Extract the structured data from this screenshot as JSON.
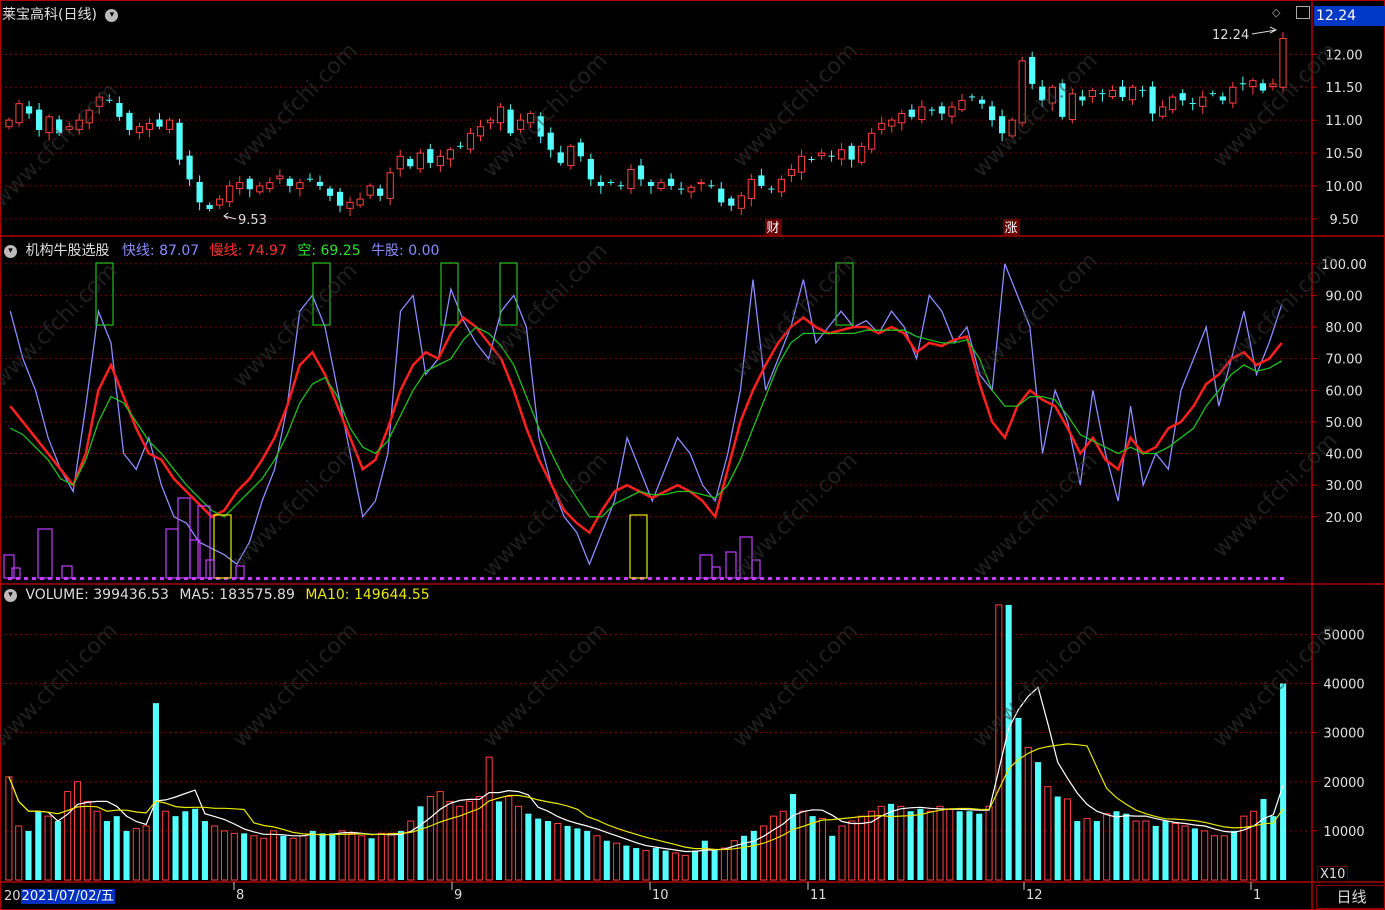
{
  "stock_title": "莱宝高科(日线)",
  "price_badge": "12.24",
  "period_tab": "日线",
  "x10_label": "X10",
  "ind_header": {
    "name": "机构牛股选股",
    "fast_label": "快线:",
    "fast": "87.07",
    "slow_label": "慢线:",
    "slow": "74.97",
    "empty_label": "空:",
    "empty": "69.25",
    "bull_label": "牛股:",
    "bull": "0.00"
  },
  "vol_header": {
    "name": "VOLUME:",
    "vol": "399436.53",
    "ma5_label": "MA5:",
    "ma5": "183575.89",
    "ma10_label": "MA10:",
    "ma10": "149644.55"
  },
  "bottom": {
    "year_prefix": "20",
    "date": "2021/07/02/五",
    "months": [
      {
        "label": "8",
        "x": 234
      },
      {
        "label": "9",
        "x": 452
      },
      {
        "label": "10",
        "x": 650
      },
      {
        "label": "11",
        "x": 808
      },
      {
        "label": "12",
        "x": 1024
      },
      {
        "label": "1",
        "x": 1251
      }
    ]
  },
  "markers": [
    {
      "text": "财",
      "x": 773
    },
    {
      "text": "涨",
      "x": 1011
    }
  ],
  "annotations": {
    "high": "12.24",
    "low": "9.53"
  },
  "watermark": "www.cfchi.com",
  "colors": {
    "up": "#ff4040",
    "down": "#54ffff",
    "slow": "#ff2020",
    "fast": "#8c8cff",
    "green": "#20c020",
    "purple": "#c040ff",
    "yellow": "#e8e800",
    "grid": "#800000",
    "frame": "#b00000"
  },
  "chart_data": [
    {
      "type": "candlestick",
      "title": "莱宝高科(日线)",
      "yticks": [
        9.5,
        10.0,
        10.5,
        11.0,
        11.5,
        12.0
      ],
      "ylim": [
        9.3,
        12.4
      ],
      "close": [
        11.0,
        11.25,
        11.1,
        10.85,
        11.05,
        10.8,
        10.9,
        11.0,
        11.15,
        11.35,
        11.3,
        11.05,
        10.85,
        10.9,
        10.95,
        10.9,
        11.0,
        10.4,
        10.1,
        9.75,
        9.65,
        9.8,
        10.0,
        10.05,
        9.95,
        10.0,
        10.05,
        10.15,
        10.0,
        10.05,
        10.1,
        10.0,
        9.85,
        9.7,
        9.75,
        9.8,
        10.0,
        9.85,
        10.2,
        10.45,
        10.3,
        10.5,
        10.35,
        10.45,
        10.55,
        10.6,
        10.8,
        10.9,
        11.0,
        11.2,
        10.8,
        11.0,
        11.1,
        10.75,
        10.55,
        10.35,
        10.6,
        10.45,
        10.1,
        10.0,
        10.05,
        10.0,
        10.25,
        10.1,
        10.0,
        10.05,
        10.0,
        9.95,
        9.98,
        10.05,
        10.0,
        9.75,
        9.7,
        9.85,
        10.1,
        10.0,
        9.95,
        10.1,
        10.25,
        10.45,
        10.4,
        10.5,
        10.45,
        10.55,
        10.4,
        10.6,
        10.8,
        10.95,
        11.0,
        11.1,
        11.05,
        11.2,
        11.15,
        11.1,
        11.2,
        11.3,
        11.35,
        11.25,
        11.0,
        10.8,
        11.0,
        11.9,
        11.55,
        11.3,
        11.5,
        11.05,
        11.4,
        11.3,
        11.45,
        11.4,
        11.45,
        11.35,
        11.5,
        11.45,
        11.1,
        11.2,
        11.35,
        11.3,
        11.25,
        11.35,
        11.4,
        11.3,
        11.5,
        11.55,
        11.6,
        11.45,
        11.55,
        12.24
      ],
      "high": 12.24,
      "low": 9.53
    },
    {
      "type": "line",
      "title": "机构牛股选股",
      "yticks": [
        20,
        30,
        40,
        50,
        60,
        70,
        80,
        90,
        100
      ],
      "ylim": [
        0,
        105
      ],
      "series": [
        {
          "name": "快线",
          "values": [
            85,
            70,
            60,
            45,
            35,
            28,
            55,
            85,
            75,
            40,
            35,
            45,
            30,
            20,
            18,
            12,
            10,
            8,
            5,
            12,
            25,
            35,
            55,
            85,
            90,
            80,
            60,
            40,
            20,
            25,
            40,
            85,
            90,
            65,
            70,
            92,
            82,
            75,
            70,
            85,
            90,
            80,
            45,
            30,
            20,
            15,
            5,
            15,
            25,
            45,
            35,
            25,
            35,
            45,
            40,
            30,
            25,
            40,
            60,
            95,
            60,
            70,
            80,
            95,
            75,
            80,
            85,
            80,
            82,
            78,
            85,
            80,
            70,
            90,
            85,
            75,
            80,
            65,
            60,
            100,
            90,
            80,
            40,
            60,
            50,
            30,
            60,
            40,
            25,
            55,
            30,
            40,
            35,
            60,
            70,
            80,
            55,
            70,
            85,
            65,
            75,
            87.07
          ]
        },
        {
          "name": "慢线",
          "values": [
            55,
            50,
            45,
            40,
            35,
            30,
            40,
            60,
            68,
            58,
            48,
            40,
            38,
            32,
            28,
            24,
            20,
            22,
            28,
            32,
            38,
            45,
            55,
            68,
            72,
            65,
            55,
            45,
            35,
            38,
            48,
            60,
            68,
            72,
            70,
            78,
            83,
            80,
            75,
            70,
            60,
            48,
            38,
            30,
            22,
            18,
            15,
            22,
            28,
            30,
            28,
            26,
            28,
            30,
            28,
            25,
            20,
            35,
            50,
            60,
            68,
            75,
            80,
            83,
            80,
            78,
            79,
            80,
            80,
            78,
            80,
            78,
            72,
            75,
            74,
            76,
            77,
            62,
            50,
            45,
            55,
            60,
            57,
            55,
            48,
            40,
            45,
            38,
            35,
            45,
            40,
            42,
            48,
            50,
            55,
            62,
            65,
            70,
            72,
            68,
            70,
            74.97
          ]
        },
        {
          "name": "空",
          "values": [
            48,
            46,
            42,
            38,
            32,
            30,
            38,
            50,
            58,
            56,
            50,
            44,
            40,
            35,
            30,
            26,
            22,
            20,
            24,
            28,
            32,
            38,
            46,
            56,
            62,
            64,
            58,
            48,
            42,
            40,
            44,
            52,
            60,
            66,
            68,
            70,
            76,
            80,
            78,
            74,
            68,
            58,
            48,
            40,
            32,
            26,
            20,
            20,
            24,
            26,
            28,
            27,
            27,
            28,
            28,
            27,
            26,
            30,
            38,
            48,
            58,
            68,
            75,
            78,
            78,
            78,
            78,
            78,
            79,
            79,
            79,
            79,
            77,
            76,
            75,
            75,
            76,
            70,
            60,
            55,
            55,
            58,
            58,
            57,
            52,
            46,
            44,
            42,
            40,
            42,
            40,
            40,
            42,
            45,
            48,
            55,
            60,
            65,
            68,
            66,
            67,
            69.25
          ]
        },
        {
          "name": "牛股",
          "values": [
            0
          ]
        }
      ]
    },
    {
      "type": "bar",
      "title": "VOLUME",
      "yticks": [
        10000,
        20000,
        30000,
        40000,
        50000
      ],
      "ylim": [
        0,
        57000
      ],
      "values": [
        21000,
        11000,
        10000,
        14000,
        13000,
        12000,
        18000,
        20000,
        16000,
        14000,
        12000,
        13000,
        10000,
        10500,
        11000,
        36000,
        14000,
        13000,
        14000,
        14500,
        12000,
        11000,
        10000,
        9500,
        9500,
        9000,
        8500,
        10000,
        9000,
        8500,
        9000,
        10000,
        9500,
        9500,
        10000,
        9500,
        9000,
        8500,
        9500,
        9500,
        10000,
        12000,
        15000,
        17000,
        18000,
        16000,
        15000,
        16000,
        17000,
        25000,
        16000,
        17000,
        15000,
        13500,
        12500,
        12000,
        11500,
        11000,
        10500,
        10000,
        9000,
        8000,
        7500,
        7000,
        6500,
        6000,
        6500,
        6000,
        5500,
        5000,
        6000,
        8000,
        6000,
        6500,
        8000,
        9000,
        10000,
        11000,
        13000,
        14000,
        17500,
        14000,
        13000,
        12500,
        9000,
        11000,
        12000,
        13000,
        14000,
        15000,
        15500,
        15000,
        14000,
        14500,
        14000,
        15000,
        14500,
        14000,
        14000,
        13500,
        15000,
        56000,
        56000,
        33000,
        27000,
        24000,
        19000,
        17000,
        16500,
        12000,
        12500,
        12000,
        13500,
        14000,
        13500,
        12000,
        12000,
        11000,
        12000,
        11500,
        11000,
        10500,
        10000,
        9000,
        9000,
        10000,
        13000,
        14000,
        16500,
        13000,
        40000
      ],
      "series_lines": [
        "MA5",
        "MA10"
      ]
    }
  ]
}
